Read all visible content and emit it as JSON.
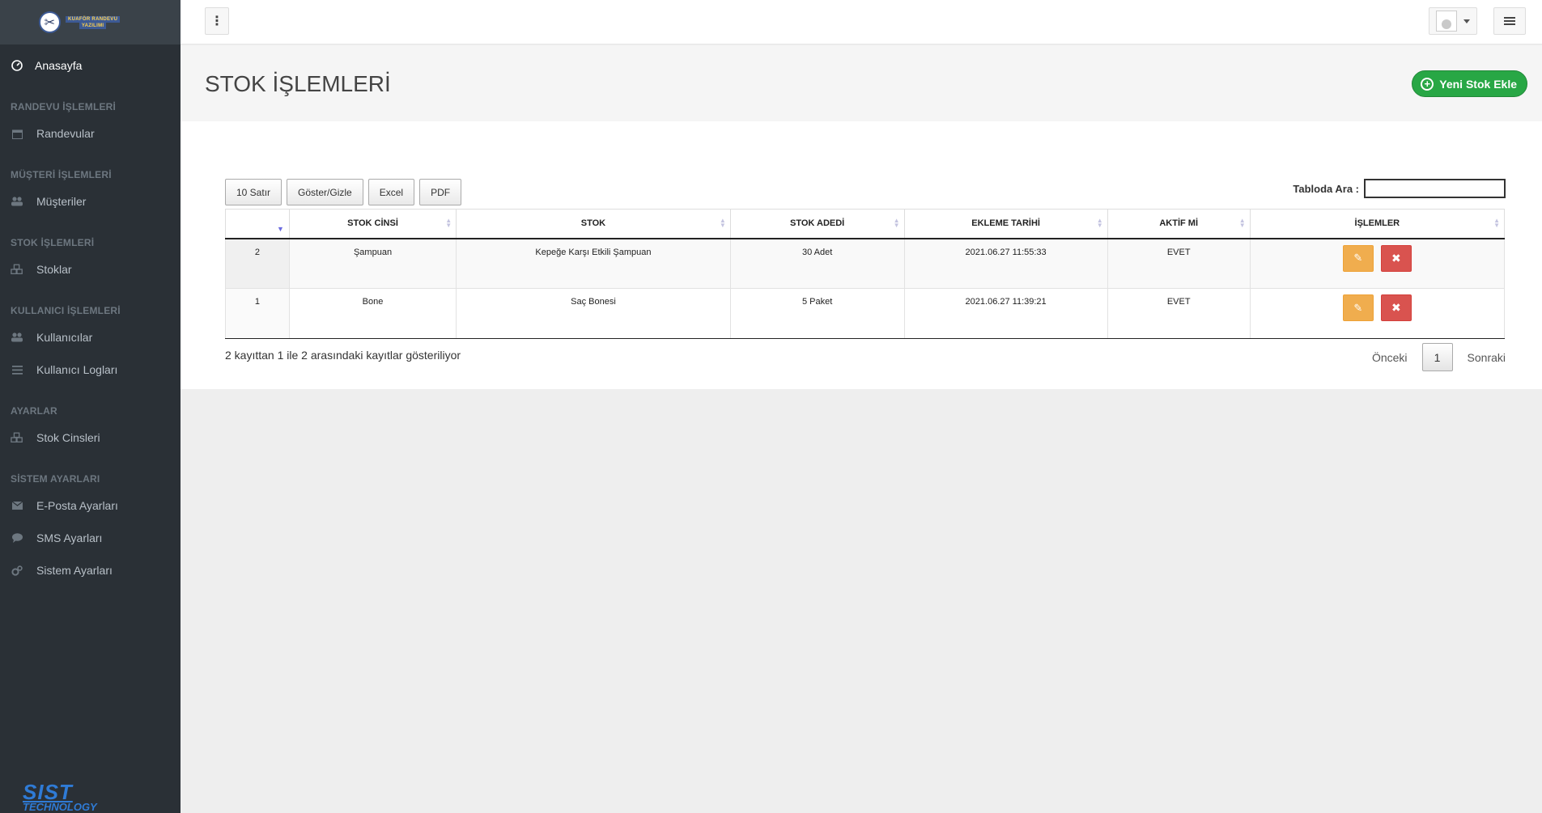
{
  "brand": {
    "logo_line1": "KUAFÖR RANDEVU",
    "logo_line2": "YAZILIMI",
    "footer_line1": "SIST",
    "footer_line2": "TECHNOLOGY"
  },
  "sidebar": {
    "home": "Anasayfa",
    "sections": [
      {
        "title": "RANDEVU İŞLEMLERİ",
        "items": [
          "Randevular"
        ]
      },
      {
        "title": "MÜŞTERİ İŞLEMLERİ",
        "items": [
          "Müşteriler"
        ]
      },
      {
        "title": "STOK İŞLEMLERİ",
        "items": [
          "Stoklar"
        ]
      },
      {
        "title": "KULLANICI İŞLEMLERİ",
        "items": [
          "Kullanıcılar",
          "Kullanıcı Logları"
        ]
      },
      {
        "title": "AYARLAR",
        "items": [
          "Stok Cinsleri"
        ]
      },
      {
        "title": "SİSTEM AYARLARI",
        "items": [
          "E-Posta Ayarları",
          "SMS Ayarları",
          "Sistem Ayarları"
        ]
      }
    ]
  },
  "page": {
    "title": "STOK İŞLEMLERİ",
    "new_button": "Yeni Stok Ekle"
  },
  "toolbar": {
    "rows": "10 Satır",
    "toggle": "Göster/Gizle",
    "excel": "Excel",
    "pdf": "PDF",
    "search_label": "Tabloda Ara :",
    "search_value": ""
  },
  "table": {
    "headers": [
      "",
      "STOK CİNSİ",
      "STOK",
      "STOK ADEDİ",
      "EKLEME TARİHİ",
      "AKTİF Mİ",
      "İŞLEMLER"
    ],
    "rows": [
      [
        "2",
        "Şampuan",
        "Kepeğe Karşı Etkili Şampuan",
        "30 Adet",
        "2021.06.27 11:55:33",
        "EVET"
      ],
      [
        "1",
        "Bone",
        "Saç Bonesi",
        "5 Paket",
        "2021.06.27 11:39:21",
        "EVET"
      ]
    ]
  },
  "footer": {
    "info": "2 kayıttan 1 ile 2 arasındaki kayıtlar gösteriliyor",
    "prev": "Önceki",
    "page": "1",
    "next": "Sonraki"
  },
  "colors": {
    "sidebar_bg": "#2a3036",
    "success": "#28a745",
    "warning": "#f0ad4e",
    "danger": "#d9534f"
  }
}
